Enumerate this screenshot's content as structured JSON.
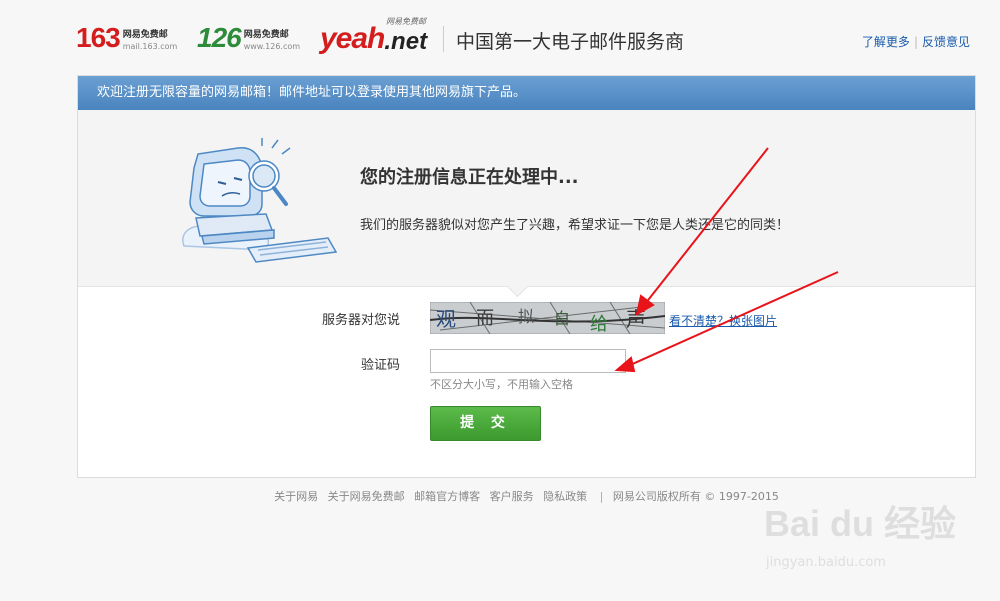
{
  "header": {
    "logo163": {
      "num": "163",
      "cn": "网易免费邮",
      "url": "mail.163.com"
    },
    "logo126": {
      "num": "126",
      "cn": "网易免费邮",
      "url": "www.126.com"
    },
    "logoyeah": {
      "yeah": "yeah",
      "net": ".net",
      "tiny": "网易免费邮"
    },
    "slogan": "中国第一大电子邮件服务商",
    "links": [
      "了解更多",
      "反馈意见"
    ],
    "link_separator": "|"
  },
  "banner": "欢迎注册无限容量的网易邮箱！邮件地址可以登录使用其他网易旗下产品。",
  "main": {
    "title": "您的注册信息正在处理中...",
    "desc": "我们的服务器貌似对您产生了兴趣，希望求证一下您是人类还是它的同类！",
    "captcha_label": "服务器对您说",
    "captcha_chars": [
      "观",
      "而",
      "拟",
      "白",
      "给",
      "声"
    ],
    "refresh_link": "看不清楚？换张图片",
    "code_label": "验证码",
    "code_value": "",
    "hint": "不区分大小写，不用输入空格",
    "submit": "提 交"
  },
  "footer": {
    "links": [
      "关于网易",
      "关于网易免费邮",
      "邮箱官方博客",
      "客户服务",
      "隐私政策"
    ],
    "separator": "|",
    "copyright": "网易公司版权所有 © 1997-2015"
  },
  "watermark": {
    "brand": "Bai du 经验",
    "url": "jingyan.baidu.com"
  },
  "colors": {
    "accent": "#4a84bf",
    "logo_red": "#d41d1d",
    "logo_green": "#2e8b3a",
    "button_green": "#3c9a2e",
    "link": "#1a5bab",
    "annotation_arrow": "#e8141a"
  }
}
